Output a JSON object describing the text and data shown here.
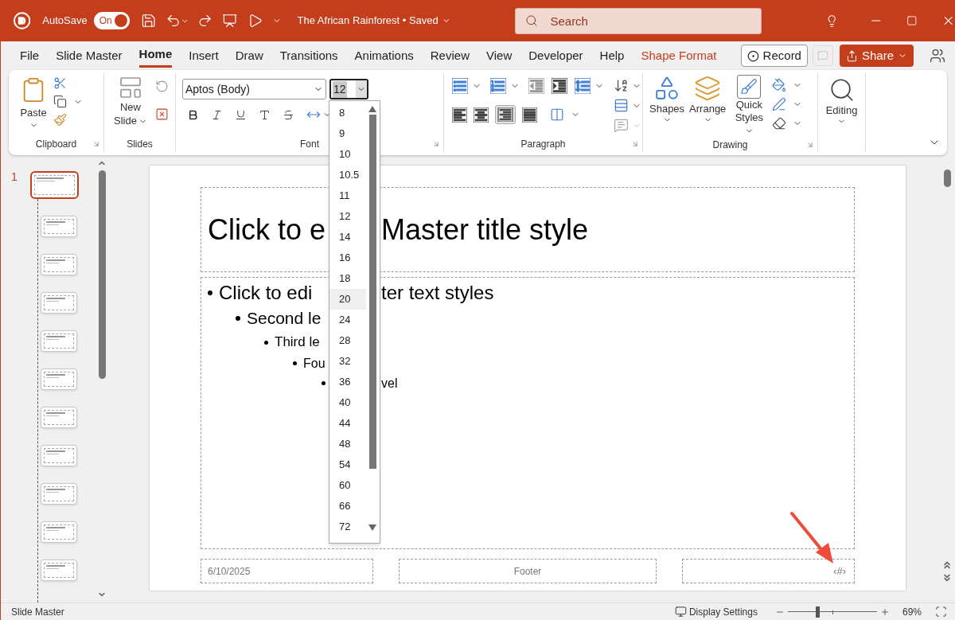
{
  "title_bar": {
    "autosave_label": "AutoSave",
    "autosave_toggle": {
      "label": "On",
      "on": true
    },
    "document_title": "The African Rainforest • Saved",
    "search": {
      "placeholder": "Search"
    }
  },
  "menu_tabs": [
    {
      "label": "File",
      "selected": false,
      "kind": "normal"
    },
    {
      "label": "Slide Master",
      "selected": false,
      "kind": "normal"
    },
    {
      "label": "Home",
      "selected": true,
      "kind": "normal"
    },
    {
      "label": "Insert",
      "selected": false,
      "kind": "normal"
    },
    {
      "label": "Draw",
      "selected": false,
      "kind": "normal"
    },
    {
      "label": "Transitions",
      "selected": false,
      "kind": "normal"
    },
    {
      "label": "Animations",
      "selected": false,
      "kind": "normal"
    },
    {
      "label": "Review",
      "selected": false,
      "kind": "normal"
    },
    {
      "label": "View",
      "selected": false,
      "kind": "normal"
    },
    {
      "label": "Developer",
      "selected": false,
      "kind": "normal"
    },
    {
      "label": "Help",
      "selected": false,
      "kind": "normal"
    },
    {
      "label": "Shape Format",
      "selected": false,
      "kind": "contextual"
    }
  ],
  "record_button": "Record",
  "share_button": "Share",
  "ribbon": {
    "clipboard": {
      "paste": "Paste",
      "label": "Clipboard"
    },
    "slides": {
      "new_slide": "New Slide",
      "label": "Slides"
    },
    "font": {
      "font_name": "Aptos (Body)",
      "font_size": "12",
      "label": "Font"
    },
    "paragraph": {
      "label": "Paragraph"
    },
    "drawing": {
      "shapes": "Shapes",
      "arrange": "Arrange",
      "quick_styles": "Quick Styles",
      "label": "Drawing"
    },
    "editing": {
      "label": "Editing"
    }
  },
  "font_size_menu": [
    {
      "label": "8",
      "selected": false
    },
    {
      "label": "9",
      "selected": false
    },
    {
      "label": "10",
      "selected": false
    },
    {
      "label": "10.5",
      "selected": false
    },
    {
      "label": "11",
      "selected": false
    },
    {
      "label": "12",
      "selected": false
    },
    {
      "label": "14",
      "selected": false
    },
    {
      "label": "16",
      "selected": false
    },
    {
      "label": "18",
      "selected": false
    },
    {
      "label": "20",
      "selected": true
    },
    {
      "label": "24",
      "selected": false
    },
    {
      "label": "28",
      "selected": false
    },
    {
      "label": "32",
      "selected": false
    },
    {
      "label": "36",
      "selected": false
    },
    {
      "label": "40",
      "selected": false
    },
    {
      "label": "44",
      "selected": false
    },
    {
      "label": "48",
      "selected": false
    },
    {
      "label": "54",
      "selected": false
    },
    {
      "label": "60",
      "selected": false
    },
    {
      "label": "66",
      "selected": false
    },
    {
      "label": "72",
      "selected": false
    }
  ],
  "thumbnails_panel": {
    "slide_number": "1",
    "thumbnails": [
      {
        "selected": true
      },
      {
        "selected": false
      },
      {
        "selected": false
      },
      {
        "selected": false
      },
      {
        "selected": false
      },
      {
        "selected": false
      },
      {
        "selected": false
      },
      {
        "selected": false
      },
      {
        "selected": false
      },
      {
        "selected": false
      },
      {
        "selected": false
      }
    ]
  },
  "slide": {
    "title": {
      "text_left": "Click to e",
      "text_right": "Master title style"
    },
    "body": [
      {
        "text_left": "Click to edi",
        "text_right": "ter text styles",
        "children": [
          {
            "text_left": "Second le",
            "children": [
              {
                "text_left": "Third le",
                "children": [
                  {
                    "text_left": "Fou",
                    "children": [
                      {
                        "text_right": "vel"
                      }
                    ]
                  }
                ]
              }
            ]
          }
        ]
      }
    ],
    "footer": {
      "date": "6/10/2025",
      "footer": "Footer",
      "slide_number": "‹#›"
    }
  },
  "status_bar": {
    "view": "Slide Master",
    "display_settings": "Display Settings",
    "zoom": {
      "level": 0.33,
      "reading": "69%"
    }
  }
}
